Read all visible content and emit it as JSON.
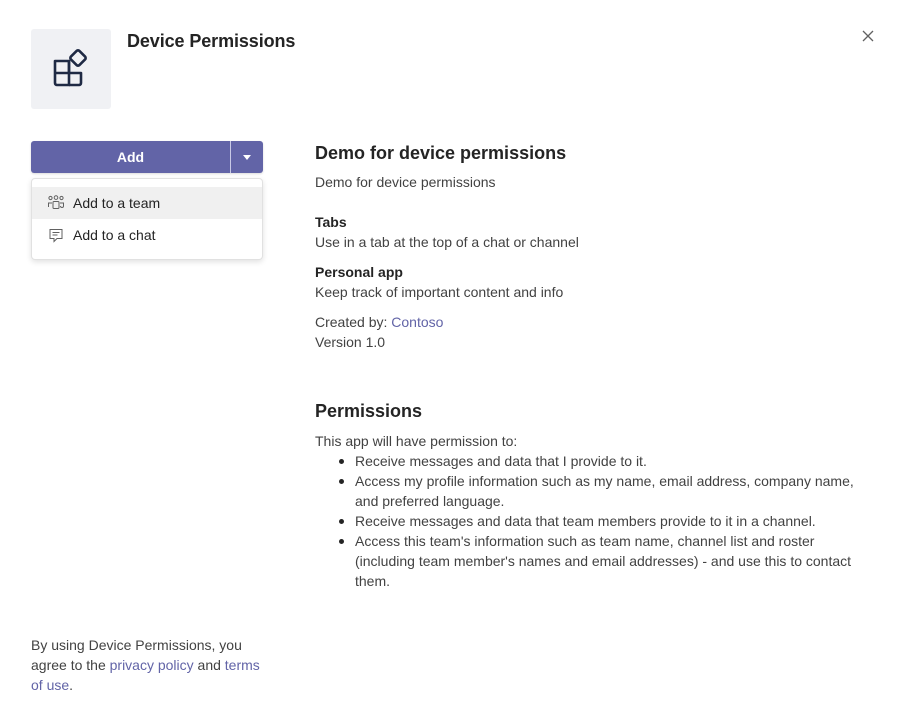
{
  "app": {
    "title": "Device Permissions",
    "icon": "apps-icon"
  },
  "close": {
    "icon": "close-icon"
  },
  "add_button": {
    "label": "Add",
    "dropdown_icon": "caret-down-icon",
    "color": "#6264a7"
  },
  "menu": {
    "items": [
      {
        "label": "Add to a team",
        "icon": "team-icon",
        "hovered": true
      },
      {
        "label": "Add to a chat",
        "icon": "chat-icon",
        "hovered": false
      }
    ]
  },
  "details": {
    "heading": "Demo for device permissions",
    "description": "Demo for device permissions",
    "sections": [
      {
        "label": "Tabs",
        "text": "Use in a tab at the top of a chat or channel"
      },
      {
        "label": "Personal app",
        "text": "Keep track of important content and info"
      }
    ],
    "created_by_label": "Created by:",
    "created_by_value": "Contoso",
    "version": "Version 1.0"
  },
  "permissions": {
    "heading": "Permissions",
    "intro": "This app will have permission to:",
    "items": [
      "Receive messages and data that I provide to it.",
      "Access my profile information such as my name, email address, company name, and preferred language.",
      "Receive messages and data that team members provide to it in a channel.",
      "Access this team's information such as team name, channel list and roster (including team member's names and email addresses) - and use this to contact them."
    ]
  },
  "footer": {
    "prefix": "By using Device Permissions, you agree to the",
    "privacy_link": "privacy policy",
    "and": "and",
    "terms_link": "terms of use",
    "suffix": "."
  },
  "colors": {
    "accent": "#6264a7",
    "text": "#242424",
    "secondary_text": "#424242",
    "tile_bg": "#f0f1f4"
  }
}
